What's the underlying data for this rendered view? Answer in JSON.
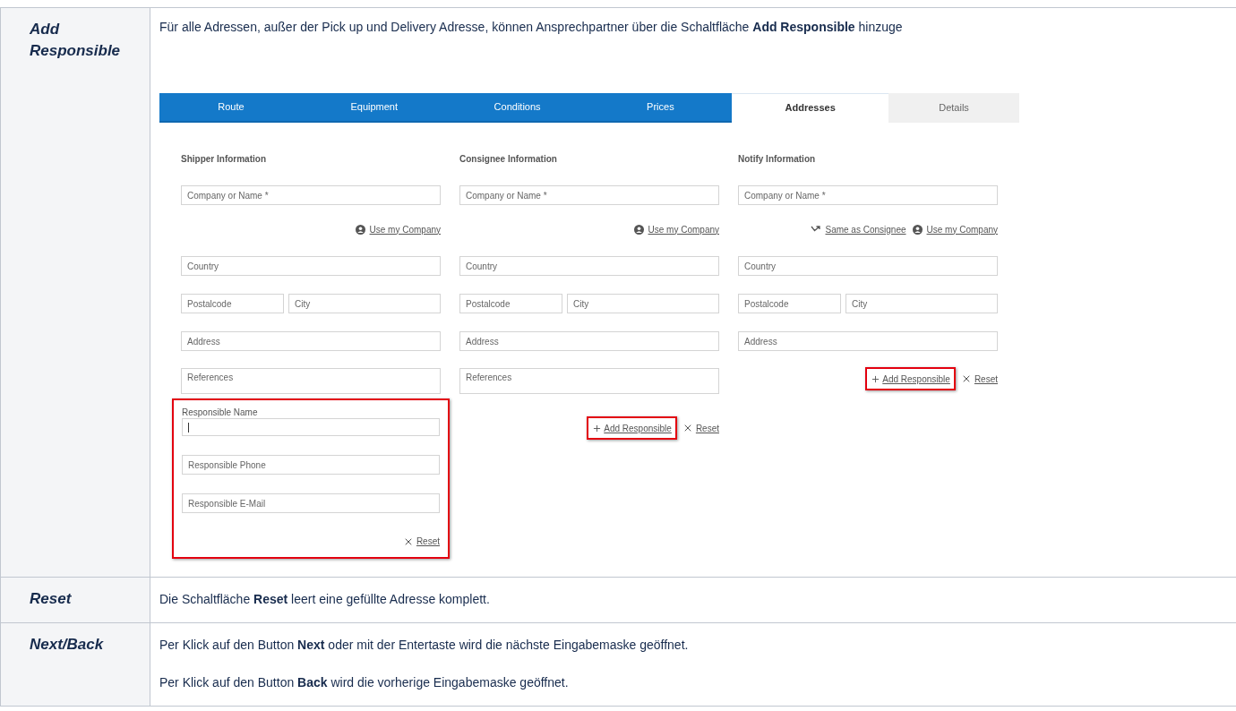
{
  "rows": [
    {
      "header": "Add Responsible",
      "paragraphs": [
        "Für alle Adressen, außer der Pick up und Delivery Adresse, können Ansprechpartner über die Schaltfläche **Add Responsible** hinzuge"
      ],
      "screenshot": {
        "tabs": [
          {
            "label": "Route",
            "selected": false,
            "disabled": false
          },
          {
            "label": "Equipment",
            "selected": false,
            "disabled": false
          },
          {
            "label": "Conditions",
            "selected": false,
            "disabled": false
          },
          {
            "label": "Prices",
            "selected": false,
            "disabled": false
          },
          {
            "label": "Addresses",
            "selected": true,
            "disabled": false
          },
          {
            "label": "Details",
            "selected": false,
            "disabled": true
          }
        ],
        "columns": [
          {
            "title": "Shipper Information",
            "company": {
              "placeholder": "Company or Name *"
            },
            "links": [
              {
                "kind": "user",
                "label": "Use my Company"
              }
            ],
            "country": {
              "placeholder": "Country"
            },
            "postalcode": {
              "placeholder": "Postalcode"
            },
            "city": {
              "placeholder": "City"
            },
            "address": {
              "placeholder": "Address"
            },
            "references": {
              "placeholder": "References"
            },
            "responsible": {
              "highlighted": true,
              "fields": [
                {
                  "placeholder": "Responsible Name",
                  "focused": true
                },
                {
                  "placeholder": "Responsible Phone",
                  "focused": false
                },
                {
                  "placeholder": "Responsible E-Mail",
                  "focused": false
                }
              ],
              "actions": [
                {
                  "kind": "reset",
                  "label": "Reset",
                  "highlighted": false
                }
              ]
            }
          },
          {
            "title": "Consignee Information",
            "company": {
              "placeholder": "Company or Name *"
            },
            "links": [
              {
                "kind": "user",
                "label": "Use my Company"
              }
            ],
            "country": {
              "placeholder": "Country"
            },
            "postalcode": {
              "placeholder": "Postalcode"
            },
            "city": {
              "placeholder": "City"
            },
            "address": {
              "placeholder": "Address"
            },
            "references": {
              "placeholder": "References"
            },
            "actions": [
              {
                "kind": "add",
                "label": "Add Responsible",
                "highlighted": true
              },
              {
                "kind": "reset",
                "label": "Reset",
                "highlighted": false
              }
            ]
          },
          {
            "title": "Notify Information",
            "company": {
              "placeholder": "Company or Name *"
            },
            "links": [
              {
                "kind": "arrow",
                "label": "Same as Consignee"
              },
              {
                "kind": "user",
                "label": "Use my Company"
              }
            ],
            "country": {
              "placeholder": "Country"
            },
            "postalcode": {
              "placeholder": "Postalcode"
            },
            "city": {
              "placeholder": "City"
            },
            "address": {
              "placeholder": "Address"
            },
            "actions": [
              {
                "kind": "add",
                "label": "Add Responsible",
                "highlighted": true
              },
              {
                "kind": "reset",
                "label": "Reset",
                "highlighted": false
              }
            ]
          }
        ]
      }
    },
    {
      "header": "Reset",
      "paragraphs": [
        "Die Schaltfläche **Reset** leert eine gefüllte Adresse komplett."
      ]
    },
    {
      "header": "Next/Back",
      "paragraphs": [
        "Per Klick auf den Button **Next** oder mit der Entertaste wird die nächste Eingabemaske geöffnet.",
        "Per Klick auf den Button **Back** wird die vorherige Eingabemaske geöffnet."
      ]
    }
  ]
}
